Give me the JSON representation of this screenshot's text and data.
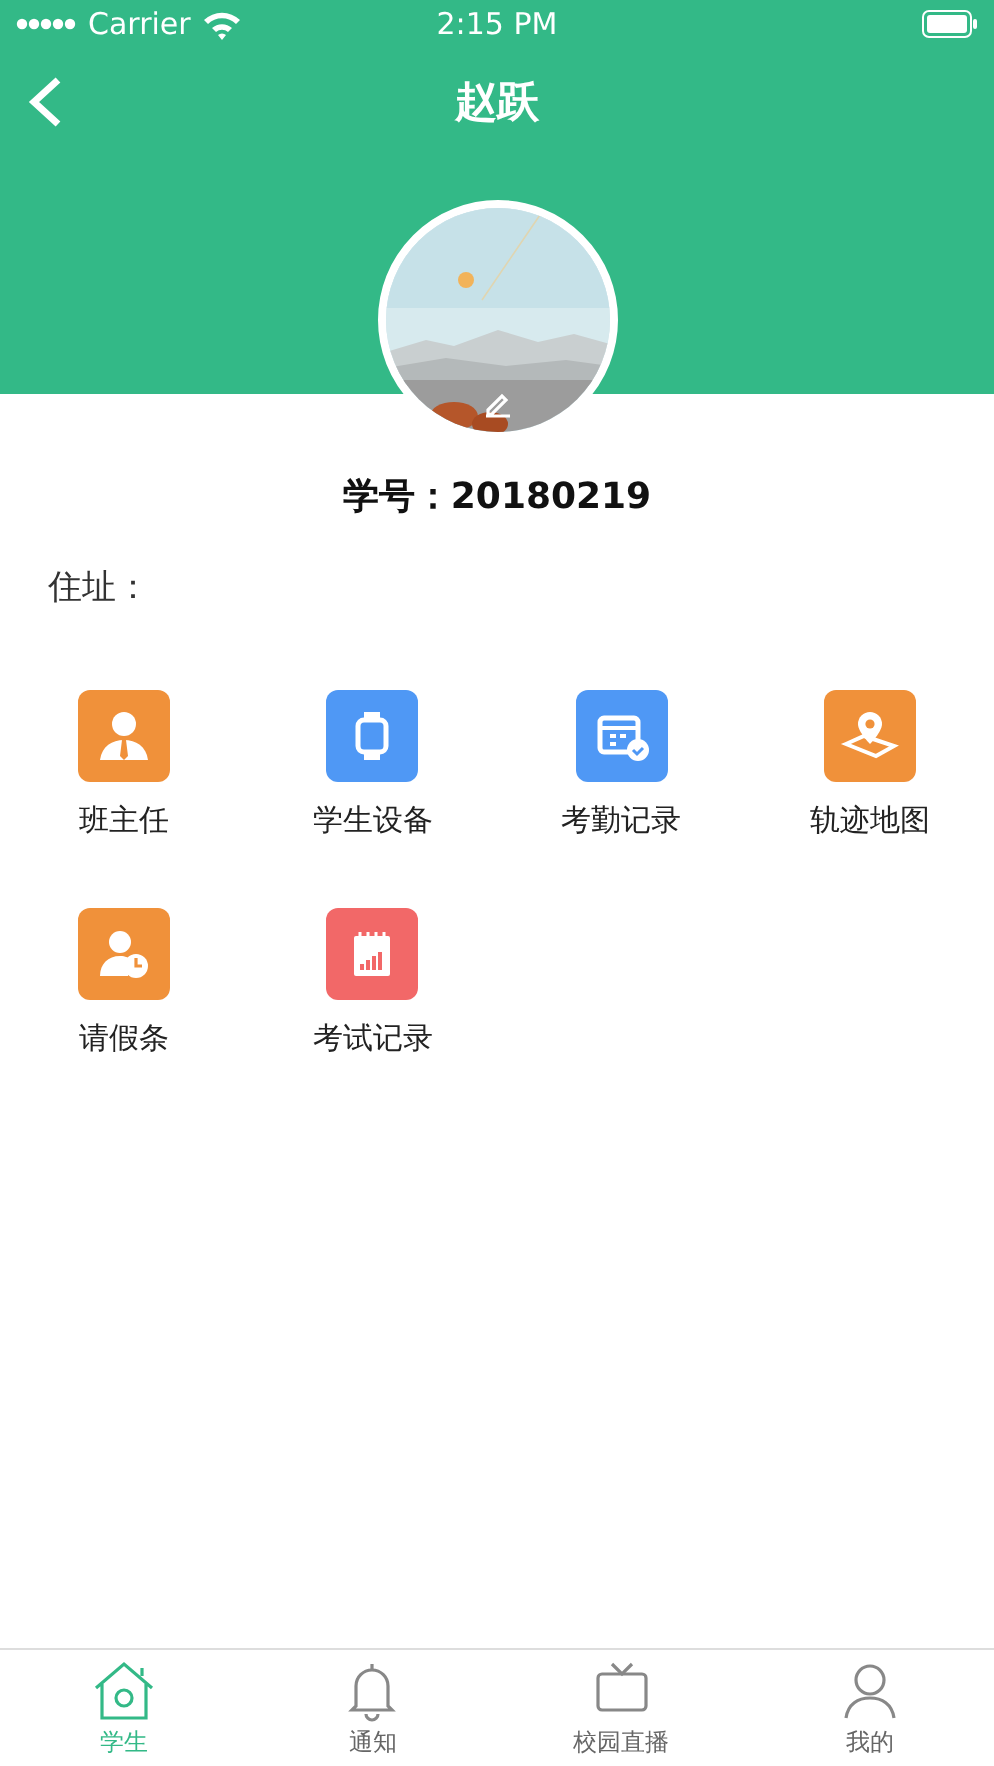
{
  "status_bar": {
    "carrier": "Carrier",
    "time": "2:15 PM"
  },
  "header": {
    "title": "赵跃"
  },
  "profile": {
    "student_id": "学号：20180219",
    "address_label": "住址："
  },
  "features": [
    {
      "label": "班主任",
      "kind": "teacher",
      "color": "#f0913a"
    },
    {
      "label": "学生设备",
      "kind": "watch",
      "color": "#4f98f5"
    },
    {
      "label": "考勤记录",
      "kind": "calendar",
      "color": "#4f98f5"
    },
    {
      "label": "轨迹地图",
      "kind": "map",
      "color": "#f0913a"
    },
    {
      "label": "请假条",
      "kind": "leave",
      "color": "#f0913a"
    },
    {
      "label": "考试记录",
      "kind": "exam",
      "color": "#f26868"
    }
  ],
  "tab_bar": [
    {
      "label": "学生",
      "kind": "home",
      "selected": true
    },
    {
      "label": "通知",
      "kind": "bell",
      "selected": false
    },
    {
      "label": "校园直播",
      "kind": "live",
      "selected": false
    },
    {
      "label": "我的",
      "kind": "user",
      "selected": false
    }
  ]
}
